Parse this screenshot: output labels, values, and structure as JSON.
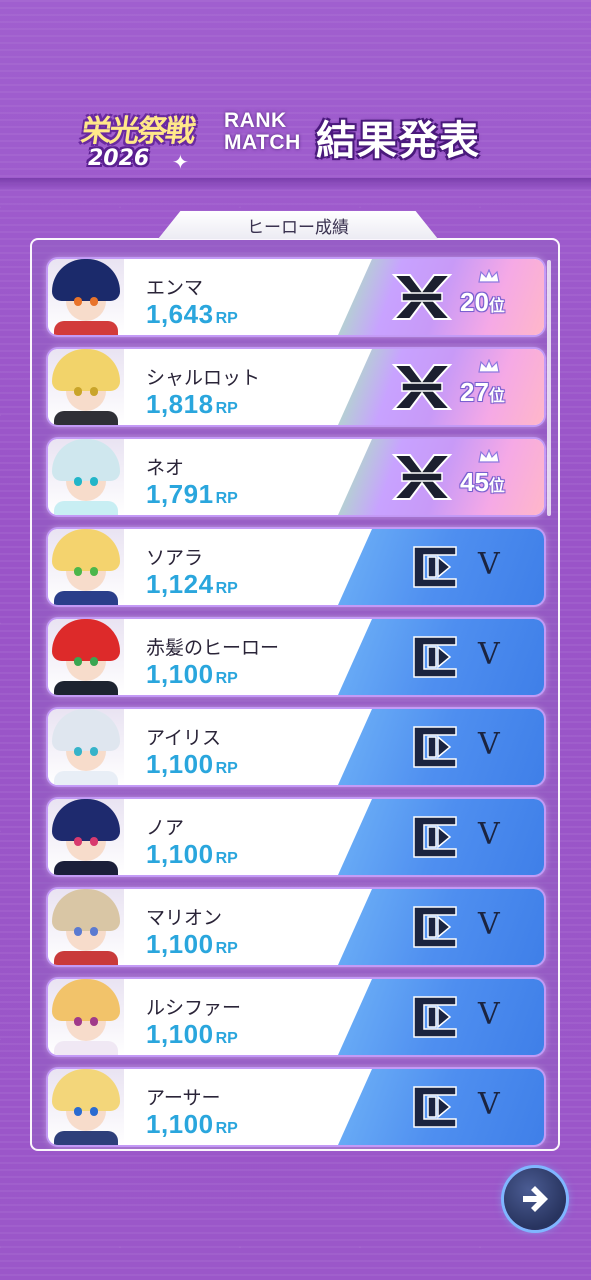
{
  "header": {
    "logo_top": "栄光祭戦",
    "logo_year": "2026",
    "rank_match_line1": "RANK",
    "rank_match_line2": "MATCH",
    "title": "結果発表"
  },
  "panel": {
    "tab_label": "ヒーロー成績"
  },
  "colors": {
    "rp_text": "#2aa6dd",
    "tier_x_gradient": "#c8a2ff",
    "tier_v_bg": "#4f8ff0",
    "accent": "#9b57c9"
  },
  "heroes": [
    {
      "name": "エンマ",
      "rp": "1,643",
      "rp_unit": "RP",
      "tier": "x",
      "place": "20",
      "place_unit": "位",
      "hair": "#1b2a6b",
      "eye": "#e8732a",
      "body": "#d23b3b"
    },
    {
      "name": "シャルロット",
      "rp": "1,818",
      "rp_unit": "RP",
      "tier": "x",
      "place": "27",
      "place_unit": "位",
      "hair": "#f2d36a",
      "eye": "#c9a42a",
      "body": "#2f2f36"
    },
    {
      "name": "ネオ",
      "rp": "1,791",
      "rp_unit": "RP",
      "tier": "x",
      "place": "45",
      "place_unit": "位",
      "hair": "#cfe7ee",
      "eye": "#22b5c8",
      "body": "#c8eef3"
    },
    {
      "name": "ソアラ",
      "rp": "1,124",
      "rp_unit": "RP",
      "tier": "v",
      "tier_label": "V",
      "hair": "#f4d36e",
      "eye": "#4bb64b",
      "body": "#2a3e8a"
    },
    {
      "name": "赤髪のヒーロー",
      "rp": "1,100",
      "rp_unit": "RP",
      "tier": "v",
      "tier_label": "V",
      "hair": "#dd2a2a",
      "eye": "#3aa652",
      "body": "#1d2330"
    },
    {
      "name": "アイリス",
      "rp": "1,100",
      "rp_unit": "RP",
      "tier": "v",
      "tier_label": "V",
      "hair": "#dfe6ef",
      "eye": "#36b3c9",
      "body": "#e8eef6"
    },
    {
      "name": "ノア",
      "rp": "1,100",
      "rp_unit": "RP",
      "tier": "v",
      "tier_label": "V",
      "hair": "#1e2a6e",
      "eye": "#d83a6e",
      "body": "#1b1f3a"
    },
    {
      "name": "マリオン",
      "rp": "1,100",
      "rp_unit": "RP",
      "tier": "v",
      "tier_label": "V",
      "hair": "#d9c6a5",
      "eye": "#5b7ad1",
      "body": "#c93a3a"
    },
    {
      "name": "ルシファー",
      "rp": "1,100",
      "rp_unit": "RP",
      "tier": "v",
      "tier_label": "V",
      "hair": "#f2c36a",
      "eye": "#a03a8a",
      "body": "#f0e8f4"
    },
    {
      "name": "アーサー",
      "rp": "1,100",
      "rp_unit": "RP",
      "tier": "v",
      "tier_label": "V",
      "hair": "#f3d67a",
      "eye": "#2a6bd1",
      "body": "#2e3f7a"
    }
  ]
}
